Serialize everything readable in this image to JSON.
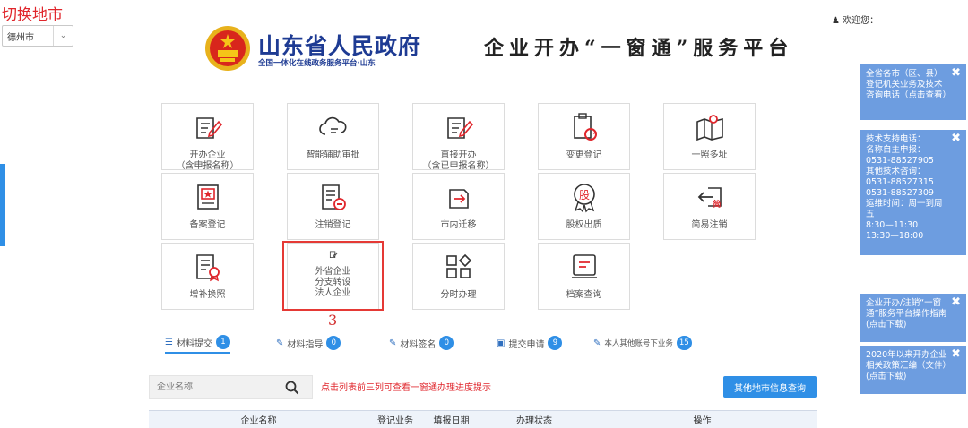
{
  "city_switch": {
    "title": "切换地市",
    "selected_city": "德州市"
  },
  "header": {
    "gov_title": "山东省人民政府",
    "gov_subtitle": "全国一体化在线政务服务平台·山东",
    "platform_title": "企业开办“一窗通”服务平台",
    "welcome": "欢迎您："
  },
  "services": [
    {
      "line1": "开办企业",
      "line2": "（含申报名称）",
      "icon": "document-edit-icon"
    },
    {
      "line1": "智能辅助审批",
      "line2": "",
      "icon": "cloud-icon"
    },
    {
      "line1": "直接开办",
      "line2": "（含已申报名称）",
      "icon": "document-edit-icon"
    },
    {
      "line1": "变更登记",
      "line2": "",
      "icon": "clipboard-refresh-icon"
    },
    {
      "line1": "一照多址",
      "line2": "",
      "icon": "map-pin-icon"
    },
    {
      "line1": "备案登记",
      "line2": "",
      "icon": "certificate-star-icon"
    },
    {
      "line1": "注销登记",
      "line2": "",
      "icon": "document-minus-icon"
    },
    {
      "line1": "市内迁移",
      "line2": "",
      "icon": "transfer-icon"
    },
    {
      "line1": "股权出质",
      "line2": "",
      "icon": "equity-seal-icon"
    },
    {
      "line1": "简易注销",
      "line2": "",
      "icon": "simple-cancel-icon"
    },
    {
      "line1": "增补换照",
      "line2": "",
      "icon": "license-reissue-icon"
    },
    {
      "line1": "外省企业\n分支转设\n法人企业",
      "line2": "",
      "icon": "small-edit-icon"
    },
    {
      "line1": "分时办理",
      "line2": "",
      "icon": "grid-diamond-icon"
    },
    {
      "line1": "档案查询",
      "line2": "",
      "icon": "archive-icon"
    }
  ],
  "annotation_number": "3",
  "tabs": [
    {
      "label": "材料提交",
      "count": "1",
      "icon": "list-icon"
    },
    {
      "label": "材料指导",
      "count": "0",
      "icon": "edit-icon"
    },
    {
      "label": "材料签名",
      "count": "0",
      "icon": "edit-icon"
    },
    {
      "label": "提交申请",
      "count": "9",
      "icon": "briefcase-icon"
    },
    {
      "label": "本人其他账号下业务",
      "count": "15",
      "icon": "edit-icon"
    }
  ],
  "search": {
    "placeholder": "企业名称",
    "tip": "点击列表前三列可查看一窗通办理进度提示",
    "other_city_button": "其他地市信息查询"
  },
  "table_headers": [
    "企业名称",
    "登记业务",
    "填报日期",
    "办理状态",
    "操作"
  ],
  "notices": [
    {
      "text": "全省各市（区、县）登记机关业务及技术咨询电话（点击查看）"
    },
    {
      "text": "技术支持电话：\n名称自主申报：\n0531-88527905\n其他技术咨询：\n0531-88527315\n0531-88527309\n运维时间：周一到周五\n8:30—11:30\n13:30—18:00"
    },
    {
      "text": "企业开办/注销“一窗通”服务平台操作指南(点击下载)"
    },
    {
      "text": "2020年以来开办企业相关政策汇编（文件）(点击下载)"
    }
  ],
  "colors": {
    "brand_blue": "#2f8fe6",
    "title_blue": "#1e3b93",
    "alert_red": "#e0262c",
    "notice_bg": "#6d9de0"
  }
}
